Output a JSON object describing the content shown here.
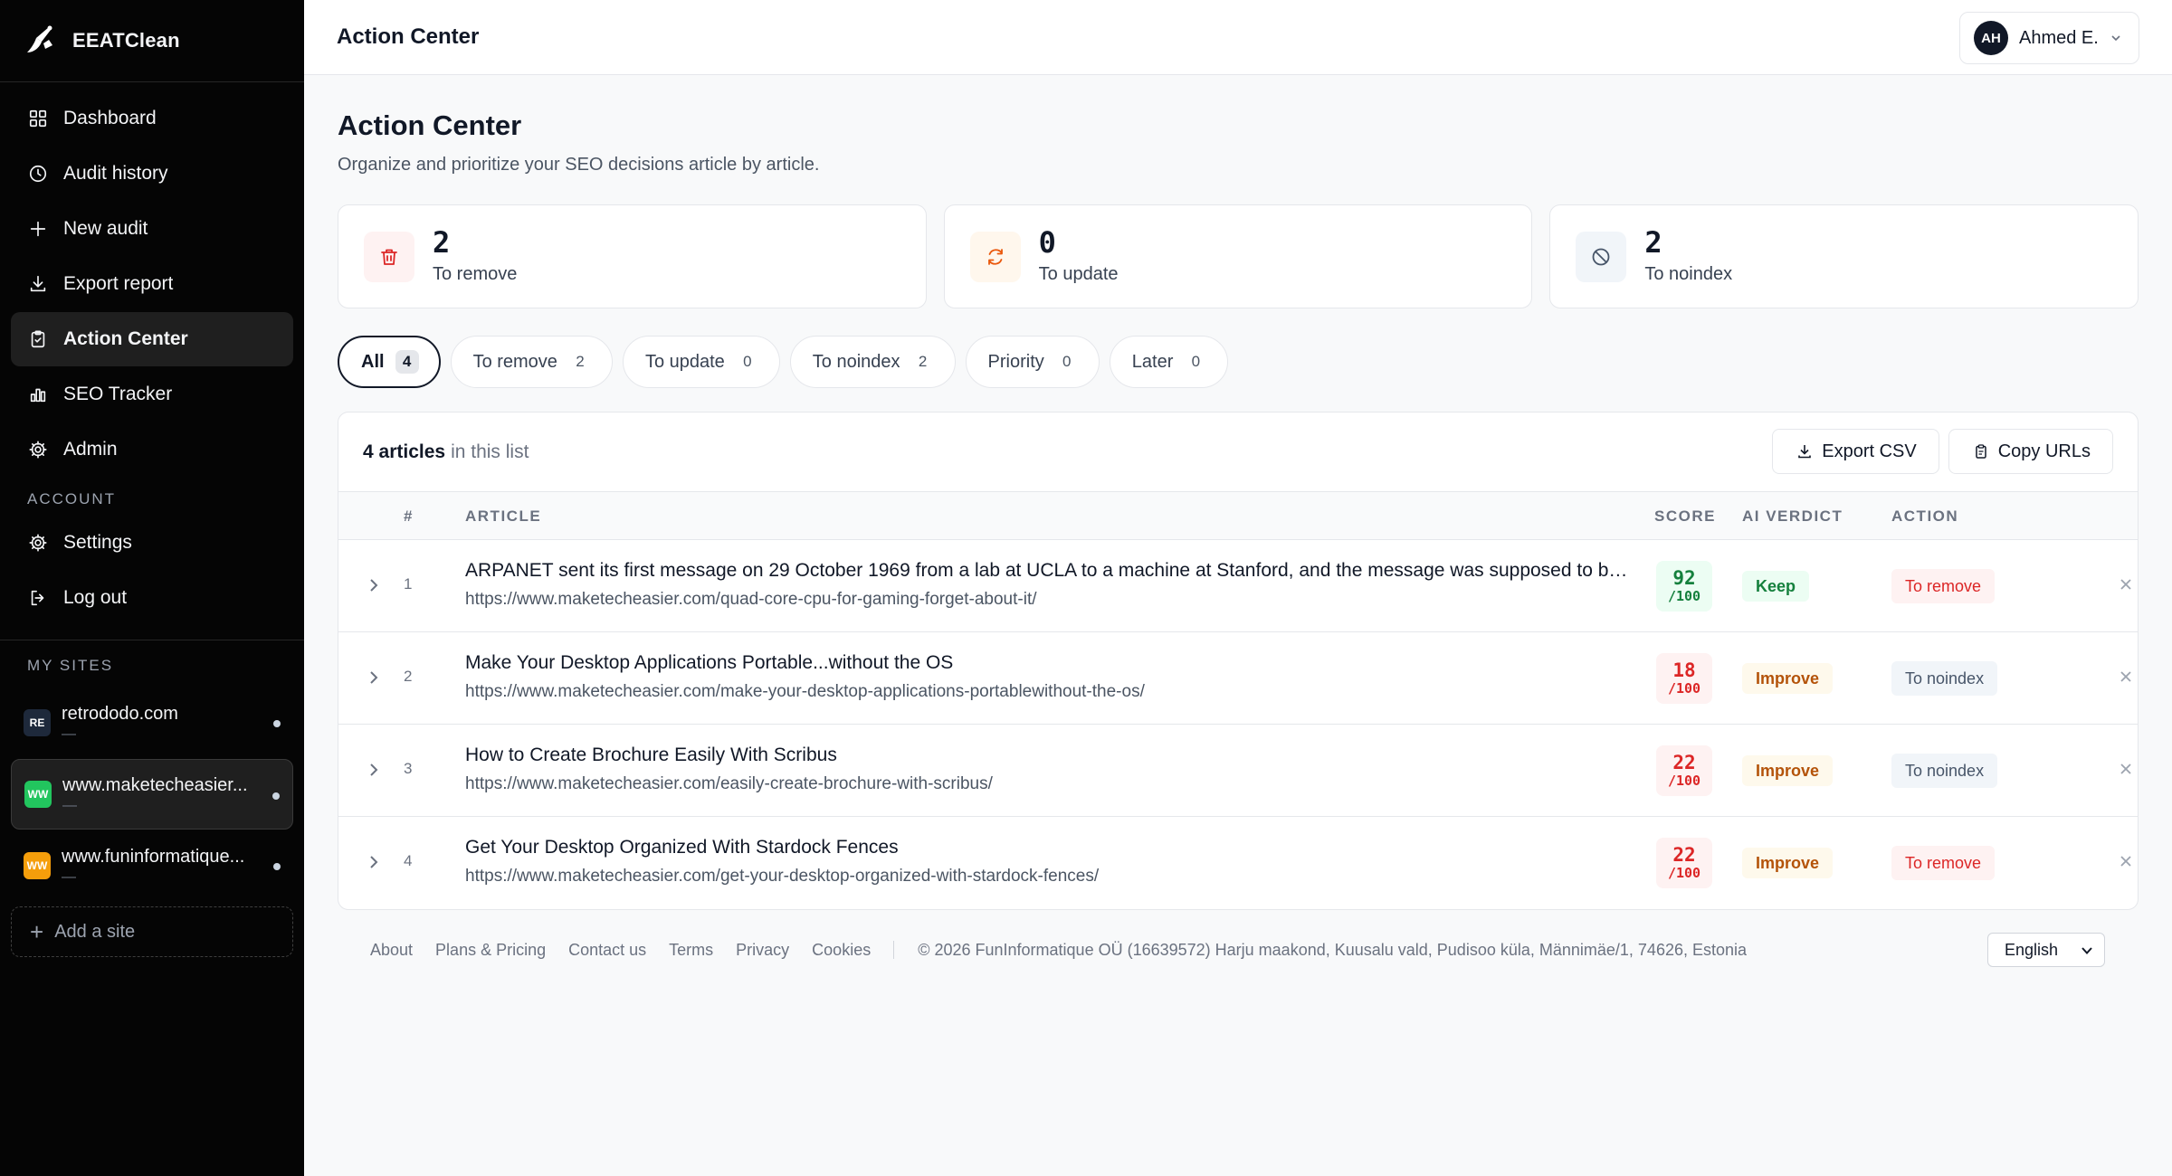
{
  "brand": {
    "name": "EEATClean"
  },
  "sidebar": {
    "nav": [
      {
        "label": "Dashboard",
        "icon": "grid-icon"
      },
      {
        "label": "Audit history",
        "icon": "clock-icon"
      },
      {
        "label": "New audit",
        "icon": "plus-icon"
      },
      {
        "label": "Export report",
        "icon": "download-icon"
      },
      {
        "label": "Action Center",
        "icon": "clipboard-icon",
        "active": true
      },
      {
        "label": "SEO Tracker",
        "icon": "bar-chart-icon"
      },
      {
        "label": "Admin",
        "icon": "gear-icon"
      }
    ],
    "account_label": "ACCOUNT",
    "account": [
      {
        "label": "Settings",
        "icon": "gear-icon"
      },
      {
        "label": "Log out",
        "icon": "logout-icon"
      }
    ],
    "sites_label": "MY SITES",
    "sites": [
      {
        "badge": "RE",
        "name": "retrododo.com",
        "sub": "—",
        "badge_bg": "#1e293b",
        "badge_fg": "#ffffff"
      },
      {
        "badge": "WW",
        "name": "www.maketecheasier...",
        "sub": "—",
        "badge_bg": "#22c55e",
        "badge_fg": "#ffffff",
        "active": true
      },
      {
        "badge": "WW",
        "name": "www.funinformatique...",
        "sub": "—",
        "badge_bg": "#f59e0b",
        "badge_fg": "#ffffff"
      }
    ],
    "add_site": "Add a site"
  },
  "header": {
    "title": "Action Center",
    "user": {
      "initials": "AH",
      "name": "Ahmed E."
    }
  },
  "page": {
    "title": "Action Center",
    "subtitle": "Organize and prioritize your SEO decisions article by article."
  },
  "stats": [
    {
      "value": "2",
      "label": "To remove",
      "icon": "trash-icon",
      "bg": "#fef2f2",
      "fg": "#dc2626"
    },
    {
      "value": "0",
      "label": "To update",
      "icon": "refresh-icon",
      "bg": "#fff7ed",
      "fg": "#ea580c"
    },
    {
      "value": "2",
      "label": "To noindex",
      "icon": "ban-icon",
      "bg": "#f1f5f9",
      "fg": "#475569"
    }
  ],
  "filters": [
    {
      "label": "All",
      "count": "4",
      "active": true
    },
    {
      "label": "To remove",
      "count": "2"
    },
    {
      "label": "To update",
      "count": "0"
    },
    {
      "label": "To noindex",
      "count": "2"
    },
    {
      "label": "Priority",
      "count": "0"
    },
    {
      "label": "Later",
      "count": "0"
    }
  ],
  "list": {
    "count_text": "4 articles",
    "rest_text": "in this list",
    "export_label": "Export CSV",
    "copy_label": "Copy URLs",
    "columns": {
      "num": "#",
      "article": "ARTICLE",
      "score": "SCORE",
      "verdict": "AI VERDICT",
      "action": "ACTION"
    },
    "rows": [
      {
        "num": "1",
        "title": "ARPANET sent its first message on 29 October 1969 from a lab at UCLA to a machine at Stanford, and the message was supposed to be LOGIN",
        "url": "https://www.maketecheasier.com/quad-core-cpu-for-gaming-forget-about-it/",
        "score": "92",
        "score_max": "/100",
        "score_class": "good",
        "verdict": "Keep",
        "verdict_class": "keep",
        "action": "To remove",
        "action_class": "remove"
      },
      {
        "num": "2",
        "title": "Make Your Desktop Applications Portable...without the OS",
        "url": "https://www.maketecheasier.com/make-your-desktop-applications-portablewithout-the-os/",
        "score": "18",
        "score_max": "/100",
        "score_class": "bad",
        "verdict": "Improve",
        "verdict_class": "improve",
        "action": "To noindex",
        "action_class": "noindex"
      },
      {
        "num": "3",
        "title": "How to Create Brochure Easily With Scribus",
        "url": "https://www.maketecheasier.com/easily-create-brochure-with-scribus/",
        "score": "22",
        "score_max": "/100",
        "score_class": "bad",
        "verdict": "Improve",
        "verdict_class": "improve",
        "action": "To noindex",
        "action_class": "noindex"
      },
      {
        "num": "4",
        "title": "Get Your Desktop Organized With Stardock Fences",
        "url": "https://www.maketecheasier.com/get-your-desktop-organized-with-stardock-fences/",
        "score": "22",
        "score_max": "/100",
        "score_class": "bad",
        "verdict": "Improve",
        "verdict_class": "improve",
        "action": "To remove",
        "action_class": "remove"
      }
    ]
  },
  "footer": {
    "links": [
      "About",
      "Plans & Pricing",
      "Contact us",
      "Terms",
      "Privacy",
      "Cookies"
    ],
    "copyright": "© 2026 FunInformatique OÜ (16639572) Harju maakond, Kuusalu vald, Pudisoo küla, Männimäe/1, 74626, Estonia",
    "language": "English"
  }
}
